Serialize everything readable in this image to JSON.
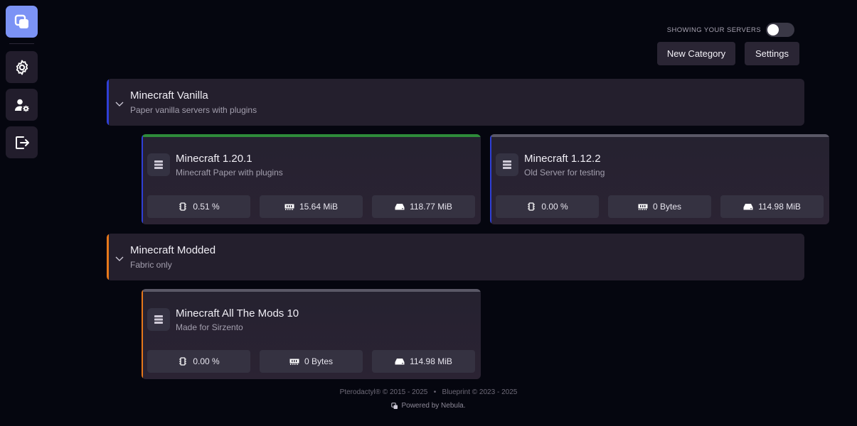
{
  "sidebar": {
    "items": [
      {
        "icon": "logo-icon"
      },
      {
        "icon": "gear-icon"
      },
      {
        "icon": "user-settings-icon"
      },
      {
        "icon": "logout-icon"
      }
    ]
  },
  "toolbar": {
    "toggle_label": "SHOWING YOUR SERVERS",
    "new_category_label": "New Category",
    "settings_label": "Settings"
  },
  "categories": [
    {
      "title": "Minecraft Vanilla",
      "description": "Paper vanilla servers with plugins",
      "accent_color": "#2f3fd6",
      "servers": [
        {
          "name": "Minecraft 1.20.1",
          "description": "Minecraft Paper with plugins",
          "status_color": "#2e8b3a",
          "cpu": "0.51 %",
          "memory": "15.64 MiB",
          "disk": "118.77 MiB"
        },
        {
          "name": "Minecraft 1.12.2",
          "description": "Old Server for testing",
          "status_color": "#5a5866",
          "cpu": "0.00 %",
          "memory": "0 Bytes",
          "disk": "114.98 MiB"
        }
      ]
    },
    {
      "title": "Minecraft Modded",
      "description": "Fabric only",
      "accent_color": "#e8781a",
      "servers": [
        {
          "name": "Minecraft All The Mods 10",
          "description": "Made for Sirzento",
          "status_color": "#5a5866",
          "cpu": "0.00 %",
          "memory": "0 Bytes",
          "disk": "114.98 MiB"
        }
      ]
    }
  ],
  "footer": {
    "copyright": "Pterodactyl® © 2015 - 2025   •   Blueprint © 2023 - 2025",
    "powered_by": "Powered by Nebula."
  }
}
